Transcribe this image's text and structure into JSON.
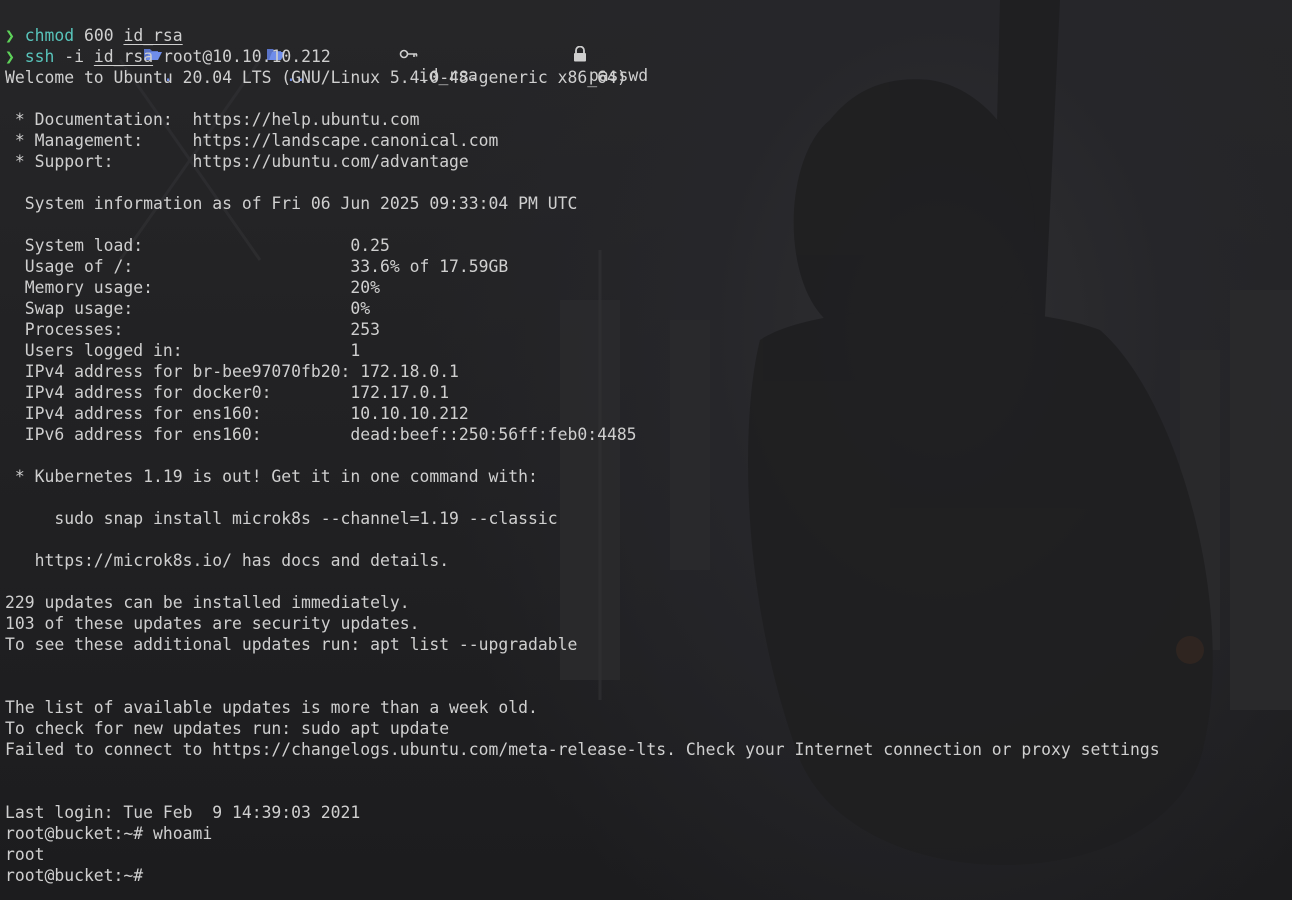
{
  "ls_row": {
    "items": [
      {
        "icon": "folder-open-icon",
        "label": "."
      },
      {
        "icon": "folder-open-icon",
        "label": ".."
      },
      {
        "icon": "key-icon",
        "label": "id_rsa"
      },
      {
        "icon": "lock-icon",
        "label": "passwd"
      }
    ]
  },
  "commands": [
    {
      "prompt": "❯",
      "command": "chmod",
      "args": [
        "600",
        "id_rsa"
      ],
      "underlined_arg_index": 1
    },
    {
      "prompt": "❯",
      "command": "ssh",
      "args": [
        "-i",
        "id_rsa",
        "root@10.10.10.212"
      ],
      "underlined_arg_index": 1
    }
  ],
  "output": {
    "welcome": "Welcome to Ubuntu 20.04 LTS (GNU/Linux 5.4.0-48-generic x86_64)",
    "links": [
      " * Documentation:  https://help.ubuntu.com",
      " * Management:     https://landscape.canonical.com",
      " * Support:        https://ubuntu.com/advantage"
    ],
    "sysinfo_header": "  System information as of Fri 06 Jun 2025 09:33:04 PM UTC",
    "sysinfo": [
      "  System load:                     0.25",
      "  Usage of /:                      33.6% of 17.59GB",
      "  Memory usage:                    20%",
      "  Swap usage:                      0%",
      "  Processes:                       253",
      "  Users logged in:                 1",
      "  IPv4 address for br-bee97070fb20: 172.18.0.1",
      "  IPv4 address for docker0:        172.17.0.1",
      "  IPv4 address for ens160:         10.10.10.212",
      "  IPv6 address for ens160:         dead:beef::250:56ff:feb0:4485"
    ],
    "k8s_line": " * Kubernetes 1.19 is out! Get it in one command with:",
    "k8s_cmd": "     sudo snap install microk8s --channel=1.19 --classic",
    "k8s_docs": "   https://microk8s.io/ has docs and details.",
    "updates": [
      "229 updates can be installed immediately.",
      "103 of these updates are security updates.",
      "To see these additional updates run: apt list --upgradable"
    ],
    "stale": [
      "The list of available updates is more than a week old.",
      "To check for new updates run: sudo apt update",
      "Failed to connect to https://changelogs.ubuntu.com/meta-release-lts. Check your Internet connection or proxy settings"
    ],
    "last_login": "Last login: Tue Feb  9 14:39:03 2021",
    "session": [
      "root@bucket:~# whoami",
      "root",
      "root@bucket:~# "
    ]
  },
  "colors": {
    "background": "#222224",
    "text": "#cfcfcf",
    "folder": "#6f8dea",
    "prompt": "#5ed35a",
    "command": "#58c4bb"
  }
}
